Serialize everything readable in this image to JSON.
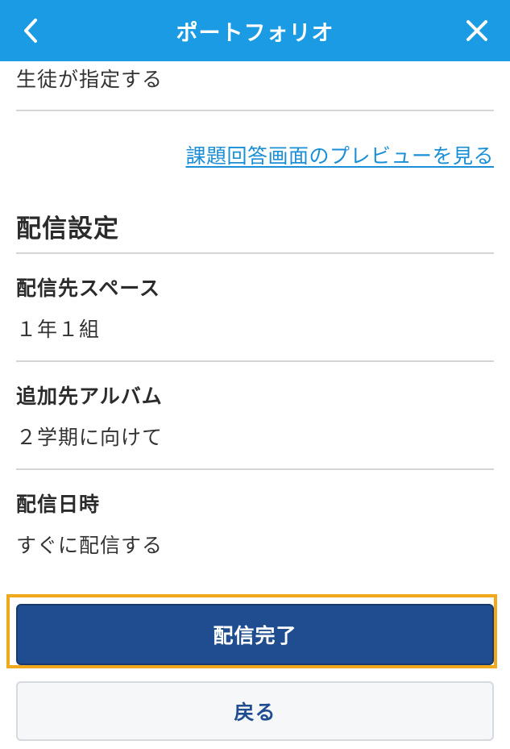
{
  "header": {
    "title": "ポートフォリオ",
    "back_icon": "chevron-left-icon",
    "close_icon": "close-icon",
    "background_color": "#1a9be3"
  },
  "answer_setting": {
    "value": "生徒が指定する"
  },
  "preview_link": {
    "label": "課題回答画面のプレビューを見る"
  },
  "delivery_settings": {
    "heading": "配信設定",
    "fields": [
      {
        "label": "配信先スペース",
        "value": "１年１組"
      },
      {
        "label": "追加先アルバム",
        "value": "２学期に向けて"
      },
      {
        "label": "配信日時",
        "value": "すぐに配信する"
      }
    ]
  },
  "actions": {
    "primary_label": "配信完了",
    "secondary_label": "戻る",
    "primary_color": "#1f4d8f",
    "highlight_color": "#f2a81d"
  }
}
